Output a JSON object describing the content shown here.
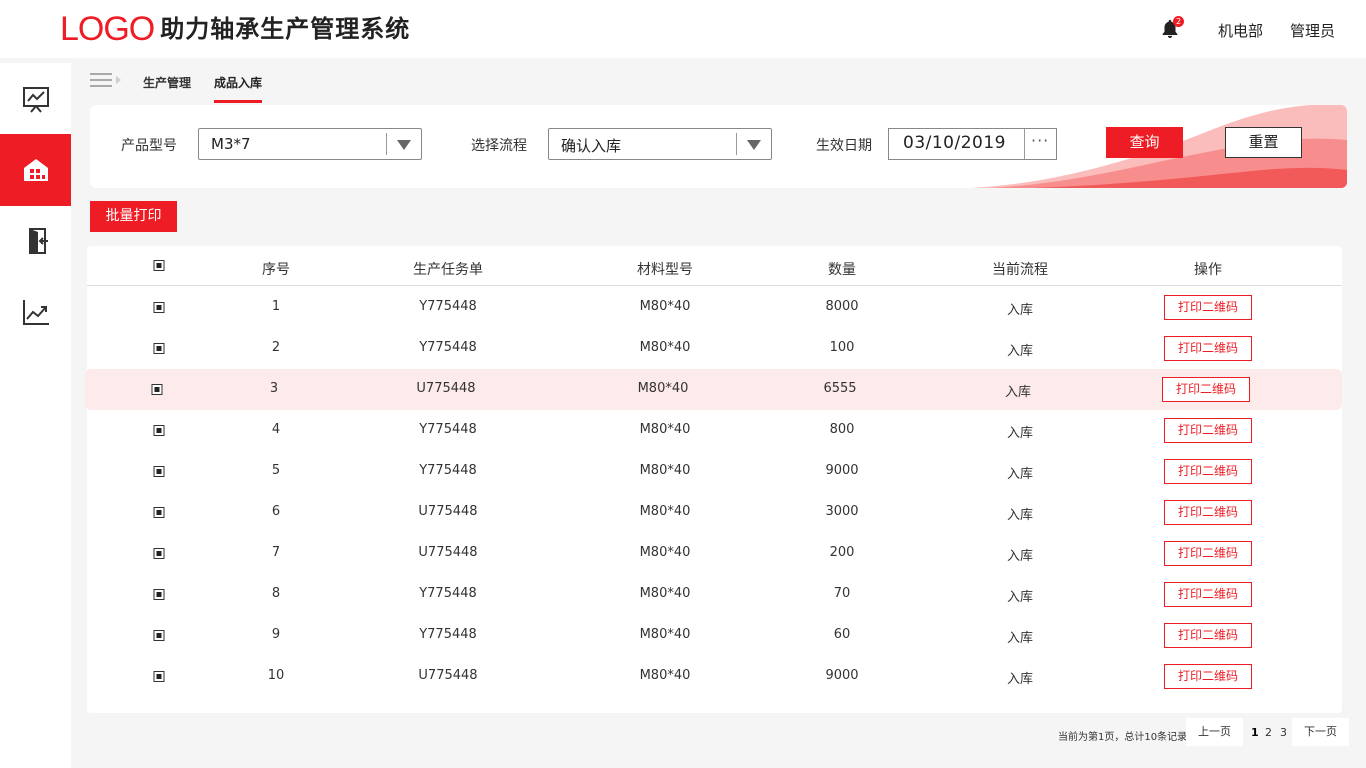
{
  "header": {
    "logo_text": "LOGO",
    "system_title": "助力轴承生产管理系统",
    "notification_count": "2",
    "department": "机电部",
    "user": "管理员"
  },
  "sidebar": {
    "items": [
      {
        "icon": "presentation-chart-icon",
        "active": false
      },
      {
        "icon": "warehouse-icon",
        "active": true
      },
      {
        "icon": "exit-door-icon",
        "active": false
      },
      {
        "icon": "trend-chart-icon",
        "active": false
      }
    ]
  },
  "breadcrumb": {
    "parent": "生产管理",
    "current": "成品入库"
  },
  "filters": {
    "product_model_label": "产品型号",
    "product_model_value": "M3*7",
    "process_label": "选择流程",
    "process_value": "确认入库",
    "date_label": "生效日期",
    "date_value": "03/10/2019",
    "date_picker_glyph": "···",
    "query_button": "查询",
    "reset_button": "重置"
  },
  "batch_print_button": "批量打印",
  "table": {
    "columns": [
      "序号",
      "生产任务单",
      "材料型号",
      "数量",
      "当前流程",
      "操作"
    ],
    "action_label": "打印二维码",
    "highlighted_row": 3,
    "rows": [
      {
        "no": "1",
        "task": "Y775448",
        "material": "M80*40",
        "qty": "8000",
        "process": "入库"
      },
      {
        "no": "2",
        "task": "Y775448",
        "material": "M80*40",
        "qty": "100",
        "process": "入库"
      },
      {
        "no": "3",
        "task": "U775448",
        "material": "M80*40",
        "qty": "6555",
        "process": "入库"
      },
      {
        "no": "4",
        "task": "Y775448",
        "material": "M80*40",
        "qty": "800",
        "process": "入库"
      },
      {
        "no": "5",
        "task": "Y775448",
        "material": "M80*40",
        "qty": "9000",
        "process": "入库"
      },
      {
        "no": "6",
        "task": "U775448",
        "material": "M80*40",
        "qty": "3000",
        "process": "入库"
      },
      {
        "no": "7",
        "task": "U775448",
        "material": "M80*40",
        "qty": "200",
        "process": "入库"
      },
      {
        "no": "8",
        "task": "Y775448",
        "material": "M80*40",
        "qty": "70",
        "process": "入库"
      },
      {
        "no": "9",
        "task": "Y775448",
        "material": "M80*40",
        "qty": "60",
        "process": "入库"
      },
      {
        "no": "10",
        "task": "U775448",
        "material": "M80*40",
        "qty": "9000",
        "process": "入库"
      }
    ]
  },
  "pagination": {
    "info": "当前为第1页，总计10条记录",
    "prev": "上一页",
    "pages": [
      "1",
      "2",
      "3"
    ],
    "current_page": "1",
    "next": "下一页"
  },
  "colors": {
    "accent": "#ee1c24",
    "highlight_row": "#fdeaea",
    "background": "#f5f5f5"
  }
}
